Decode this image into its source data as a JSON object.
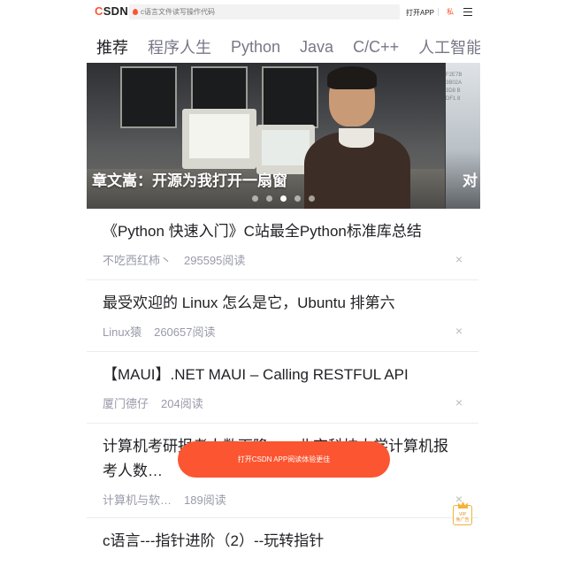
{
  "header": {
    "logo": "CSDN",
    "search_placeholder": "c语言文件读写操作代码",
    "open_app_label": "打开APP",
    "note_label": "私"
  },
  "tabs": [
    {
      "label": "推荐",
      "active": true
    },
    {
      "label": "程序人生",
      "active": false
    },
    {
      "label": "Python",
      "active": false
    },
    {
      "label": "Java",
      "active": false
    },
    {
      "label": "C/C++",
      "active": false
    },
    {
      "label": "人工智能",
      "active": false
    }
  ],
  "banner": {
    "title": "章文嵩：开源为我打开一扇窗",
    "next_title": "对",
    "next_slide_text": "F2E7B\n3B02A\n3D8 B\nDF1 8",
    "dots": 5,
    "active_dot": 2
  },
  "feed": [
    {
      "title": "《Python 快速入门》C站最全Python标准库总结",
      "author": "不吃西红柿丶",
      "reads": "295595阅读"
    },
    {
      "title": "最受欢迎的 Linux 怎么是它，Ubuntu 排第六",
      "author": "Linux猿",
      "reads": "260657阅读"
    },
    {
      "title": "【MAUI】.NET MAUI – Calling RESTFUL API",
      "author": "厦门德仔",
      "reads": "204阅读"
    },
    {
      "title": "计算机考研报考人数下降，…北京科技大学计算机报考人数…",
      "author": "计算机与软…",
      "reads": "189阅读"
    },
    {
      "title": "c语言---指针进阶（2）--玩转指针",
      "author": "",
      "reads": ""
    }
  ],
  "close_glyph": "×",
  "float_button_label": "打开CSDN APP阅读体验更佳",
  "vip_badge": {
    "line1": "VIP",
    "line2": "免广告"
  },
  "colors": {
    "accent": "#fc5531",
    "text": "#222226",
    "muted": "#999aaa"
  }
}
